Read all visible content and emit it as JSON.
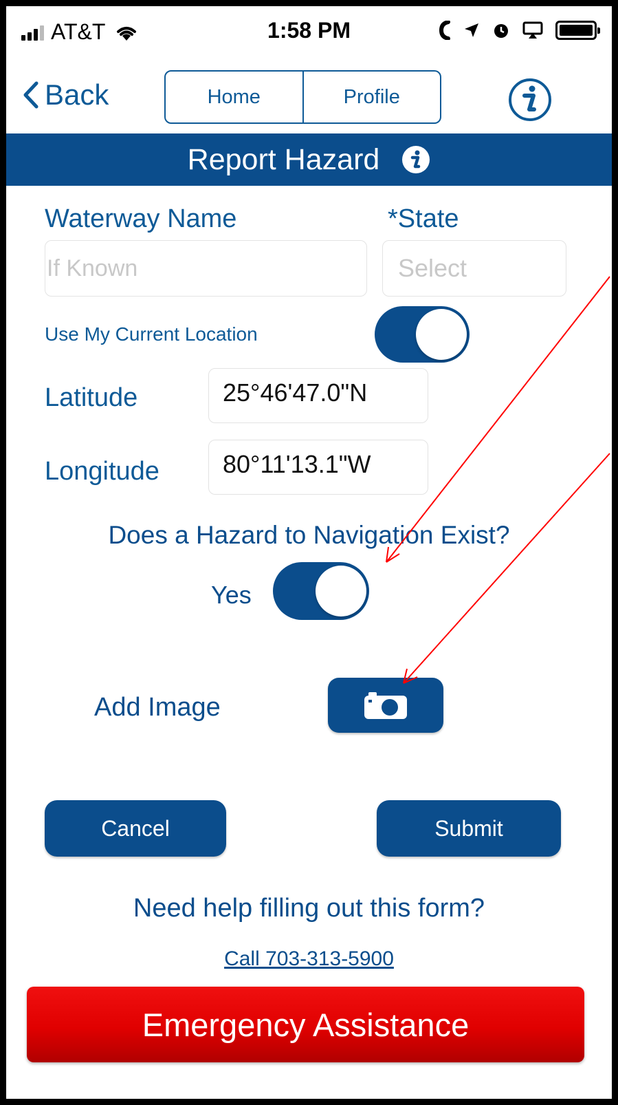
{
  "status_bar": {
    "carrier": "AT&T",
    "time": "1:58 PM"
  },
  "nav": {
    "back_label": "Back",
    "tabs": [
      {
        "label": "Home"
      },
      {
        "label": "Profile"
      }
    ]
  },
  "header": {
    "title": "Report Hazard"
  },
  "form": {
    "waterway": {
      "label": "Waterway Name",
      "placeholder": "If Known"
    },
    "state": {
      "label": "*State",
      "placeholder": "Select"
    },
    "use_location": {
      "label": "Use My Current Location",
      "on": true
    },
    "latitude": {
      "label": "Latitude",
      "value": "25°46'47.0\"N"
    },
    "longitude": {
      "label": "Longitude",
      "value": "80°11'13.1\"W"
    },
    "hazard_question": "Does a Hazard to Navigation Exist?",
    "hazard_toggle": {
      "label": "Yes",
      "on": true
    },
    "add_image_label": "Add Image"
  },
  "actions": {
    "cancel": "Cancel",
    "submit": "Submit"
  },
  "help": {
    "question": "Need help filling out this form?",
    "phone_link": "Call 703-313-5900"
  },
  "emergency": {
    "label": "Emergency Assistance"
  },
  "colors": {
    "primary": "#0b4d8c",
    "emergency": "#e00000",
    "annotation_arrow": "#ff0000"
  }
}
